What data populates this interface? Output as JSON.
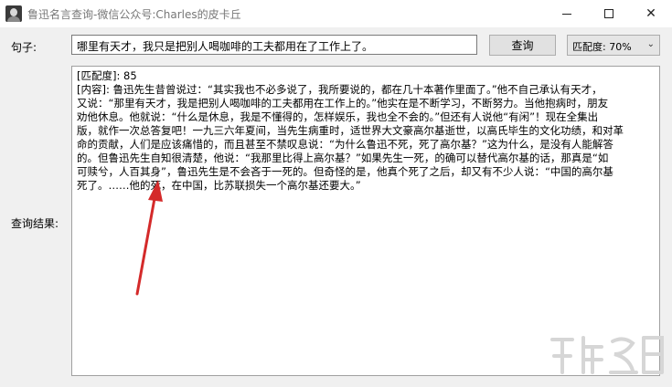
{
  "window": {
    "title": "鲁迅名言查询-微信公众号:Charles的皮卡丘",
    "minimize_glyph": "",
    "close_glyph": "✕"
  },
  "form": {
    "sentence_label": "句子:",
    "sentence_value": "哪里有天才，我只是把别人喝咖啡的工夫都用在了工作上了。",
    "query_button": "查询",
    "match_select": {
      "selected": "匹配度: 70%",
      "chevron": "⌄"
    },
    "result_label": "查询结果:"
  },
  "result": {
    "lines": [
      "[匹配度]: 85",
      "[内容]: 鲁迅先生昔曾说过：“其实我也不必多说了，我所要说的，都在几十本著作里面了。”他不自己承认有天才，",
      "又说：“那里有天才，我是把别人喝咖啡的工夫都用在工作上的。”他实在是不断学习，不断努力。当他抱病时，朋友",
      "劝他休息。他就说：“什么是休息，我是不懂得的，怎样娱乐，我也全不会的。”但还有人说他“有闲”！现在全集出",
      "版，就作一次总答复吧！一九三六年夏间，当先生病重时，适世界大文豪高尔基逝世，以高氏毕生的文化功绩，和对革",
      "命的贡献，人们是应该痛惜的，而且甚至不禁叹息说：“为什么鲁迅不死，死了高尔基？”这为什么，是没有人能解答",
      "的。但鲁迅先生自知很清楚，他说：“我那里比得上高尔基？”如果先生一死，的确可以替代高尔基的话，那真是“如",
      "可赎兮，人百其身”，鲁迅先生是不会吝于一死的。但奇怪的是，他真个死了之后，却又有不少人说：“中国的高尔基",
      "死了。……他的死，在中国，比苏联损失一个高尔基还要大。”"
    ]
  },
  "annotation": {
    "arrow_color": "#d42a2a"
  }
}
